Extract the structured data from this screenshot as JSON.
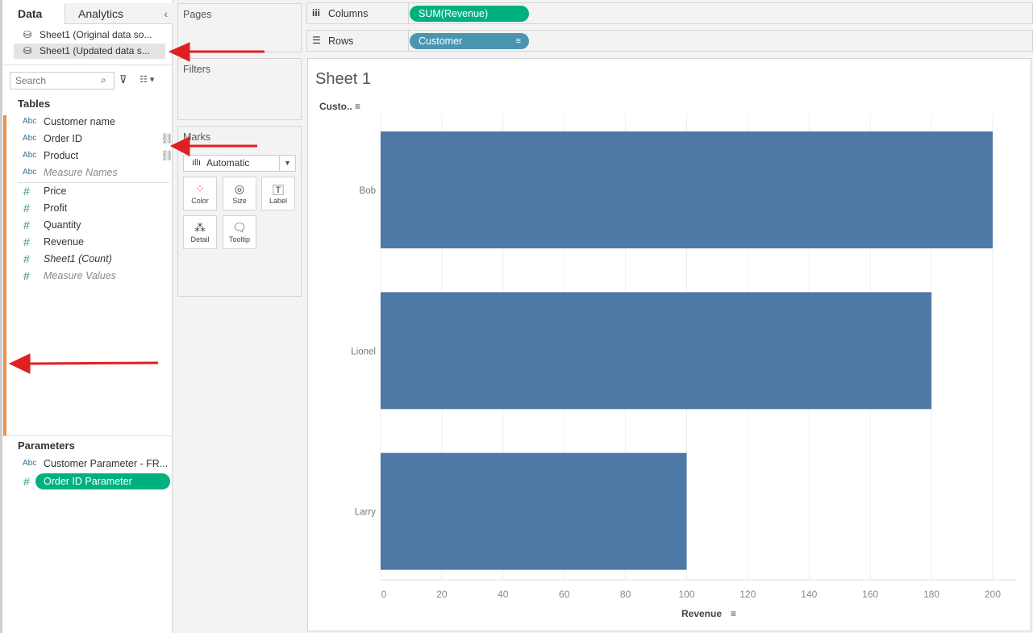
{
  "left_panel": {
    "tabs": {
      "data": "Data",
      "analytics": "Analytics"
    },
    "data_sources": [
      "Sheet1 (Original data so...",
      "Sheet1 (Updated data s..."
    ],
    "search_placeholder": "Search",
    "tables_heading": "Tables",
    "dimensions": [
      {
        "type": "Abc",
        "name": "Customer name"
      },
      {
        "type": "Abc",
        "name": "Order ID"
      },
      {
        "type": "Abc",
        "name": "Product"
      },
      {
        "type": "Abc",
        "name": "Measure Names"
      }
    ],
    "measures": [
      {
        "type": "#",
        "name": "Price"
      },
      {
        "type": "#",
        "name": "Profit"
      },
      {
        "type": "#",
        "name": "Quantity"
      },
      {
        "type": "#",
        "name": "Revenue"
      },
      {
        "type": "#",
        "name": "Sheet1 (Count)"
      },
      {
        "type": "#",
        "name": "Measure Values"
      }
    ],
    "parameters_heading": "Parameters",
    "parameters": [
      {
        "type": "Abc",
        "name": "Customer Parameter - FR..."
      },
      {
        "type": "#",
        "name": "Order ID Parameter"
      }
    ]
  },
  "cards": {
    "pages": "Pages",
    "filters": "Filters",
    "marks": "Marks",
    "mark_type": "Automatic",
    "mark_buttons": [
      "Color",
      "Size",
      "Label",
      "Detail",
      "Tooltip"
    ]
  },
  "shelves": {
    "columns_label": "Columns",
    "columns_pill": "SUM(Revenue)",
    "rows_label": "Rows",
    "rows_pill": "Customer"
  },
  "colors": {
    "measure_pill": "#00b180",
    "dimension_pill": "#4996b2",
    "bar": "#4e79a7",
    "accent": "#f28e4b",
    "arrow": "#e02020"
  },
  "chart_data": {
    "type": "bar",
    "orientation": "horizontal",
    "title": "Sheet 1",
    "row_header": "Custo..",
    "categories": [
      "Bob",
      "Lionel",
      "Larry"
    ],
    "values": [
      200,
      180,
      100
    ],
    "xlabel": "Revenue",
    "ylabel": "Customer",
    "xlim": [
      0,
      200
    ],
    "xticks": [
      0,
      20,
      40,
      60,
      80,
      100,
      120,
      140,
      160,
      180,
      200
    ],
    "grid": true
  }
}
